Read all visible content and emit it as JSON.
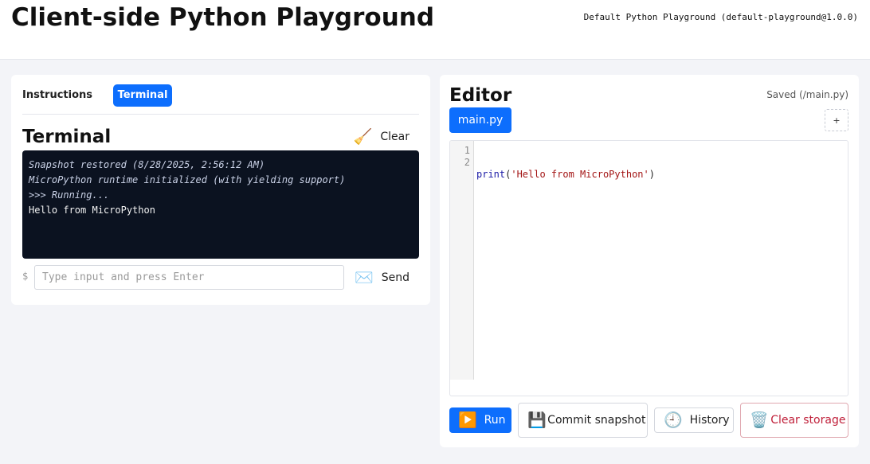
{
  "header": {
    "title": "Client-side Python Playground",
    "config": "Default Python Playground (default-playground@1.0.0)"
  },
  "left": {
    "tabs": [
      {
        "label": "Instructions",
        "active": false
      },
      {
        "label": "Terminal",
        "active": true
      }
    ],
    "terminal": {
      "heading": "Terminal",
      "clear_label": "Clear",
      "clear_icon": "🧹",
      "lines": [
        {
          "text": "Snapshot restored (8/28/2025, 2:56:12 AM)",
          "kind": "system"
        },
        {
          "text": "MicroPython runtime initialized (with yielding support)",
          "kind": "system"
        },
        {
          "text": ">>> Running...",
          "kind": "system"
        },
        {
          "text": "Hello from MicroPython",
          "kind": "output"
        }
      ],
      "prompt": "$",
      "input_placeholder": "Type input and press Enter",
      "input_value": "",
      "send_label": "Send",
      "send_icon": "✉️"
    }
  },
  "right": {
    "heading": "Editor",
    "saved_status": "Saved (/main.py)",
    "file_tabs": [
      {
        "label": "main.py",
        "active": true
      }
    ],
    "add_file_label": "+",
    "code": {
      "line_numbers": [
        "1",
        "2"
      ],
      "line1": {
        "fn": "print",
        "open": "(",
        "str": "'Hello from MicroPython'",
        "close": ")"
      },
      "line2": ""
    },
    "actions": {
      "run_label": "Run",
      "run_icon": "▶️",
      "commit_label": "Commit snapshot",
      "commit_icon": "💾",
      "history_label": "History",
      "history_icon": "🕘",
      "clear_storage_label": "Clear storage",
      "clear_storage_icon": "🗑️"
    }
  },
  "colors": {
    "accent": "#0d6efd",
    "terminal_bg": "#0b1220",
    "danger": "#c0203a"
  }
}
